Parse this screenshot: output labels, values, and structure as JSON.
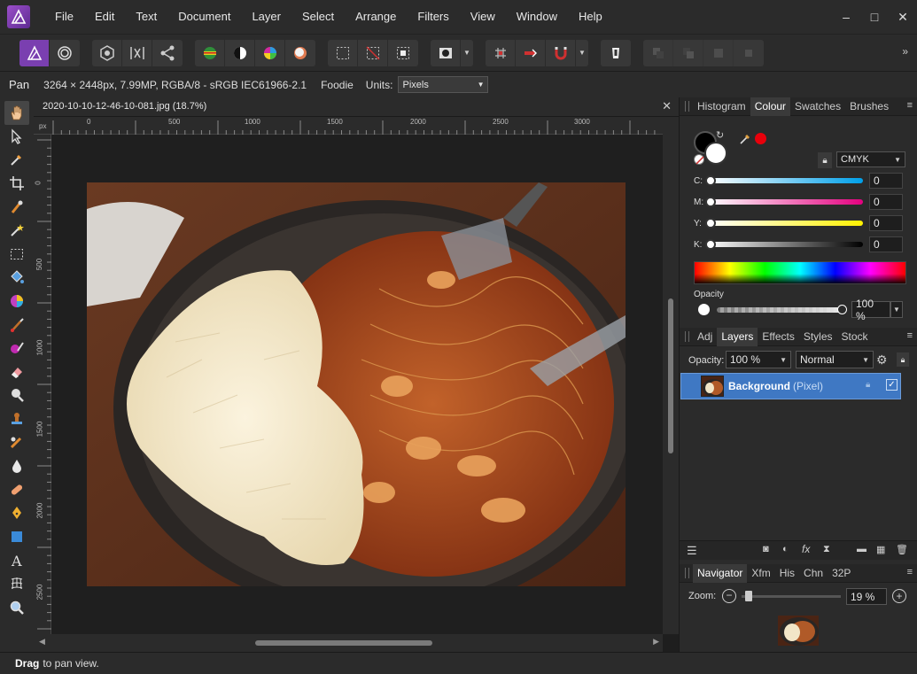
{
  "menu": {
    "items": [
      "File",
      "Edit",
      "Text",
      "Document",
      "Layer",
      "Select",
      "Arrange",
      "Filters",
      "View",
      "Window",
      "Help"
    ]
  },
  "window_controls": {
    "minimize": "–",
    "maximize": "□",
    "close": "✕"
  },
  "context": {
    "tool": "Pan",
    "info": "3264 × 2448px, 7.99MP, RGBA/8 - sRGB IEC61966-2.1",
    "preset": "Foodie",
    "units_label": "Units:",
    "units_value": "Pixels"
  },
  "document": {
    "title": "2020-10-10-12-46-10-081.jpg (18.7%)",
    "ruler_unit": "px",
    "ruler_top_ticks": [
      "0",
      "500",
      "1000",
      "1500",
      "2000",
      "2500",
      "3000"
    ],
    "ruler_left_ticks": [
      "0",
      "500",
      "1000",
      "1500",
      "2000",
      "2500"
    ]
  },
  "status": {
    "bold": "Drag",
    "text": "to pan view."
  },
  "colour_panel": {
    "tabs": [
      "Histogram",
      "Colour",
      "Swatches",
      "Brushes"
    ],
    "active_tab": "Colour",
    "mode": "CMYK",
    "sliders": [
      {
        "label": "C:",
        "value": "0",
        "gradient": "linear-gradient(90deg,#ffffff,#00a0e9)"
      },
      {
        "label": "M:",
        "value": "0",
        "gradient": "linear-gradient(90deg,#ffffff,#e4007f)"
      },
      {
        "label": "Y:",
        "value": "0",
        "gradient": "linear-gradient(90deg,#ffffff,#fff100)"
      },
      {
        "label": "K:",
        "value": "0",
        "gradient": "linear-gradient(90deg,#ffffff,#000000)"
      }
    ],
    "opacity_label": "Opacity",
    "opacity_value": "100 %",
    "accent_red": "#e8000b"
  },
  "layers_panel": {
    "tabs": [
      "Adj",
      "Layers",
      "Effects",
      "Styles",
      "Stock"
    ],
    "active_tab": "Layers",
    "opacity_label": "Opacity:",
    "opacity_value": "100 %",
    "blend_mode": "Normal",
    "layers": [
      {
        "name": "Background",
        "type": "(Pixel)"
      }
    ],
    "selected_color": "#3f78c3"
  },
  "navigator_panel": {
    "tabs": [
      "Navigator",
      "Xfm",
      "His",
      "Chn",
      "32P"
    ],
    "active_tab": "Navigator",
    "zoom_label": "Zoom:",
    "zoom_value": "19 %"
  },
  "colors": {
    "accent": "#7a3fb0",
    "panel": "#2b2b2b",
    "selection": "#3f78c3"
  }
}
